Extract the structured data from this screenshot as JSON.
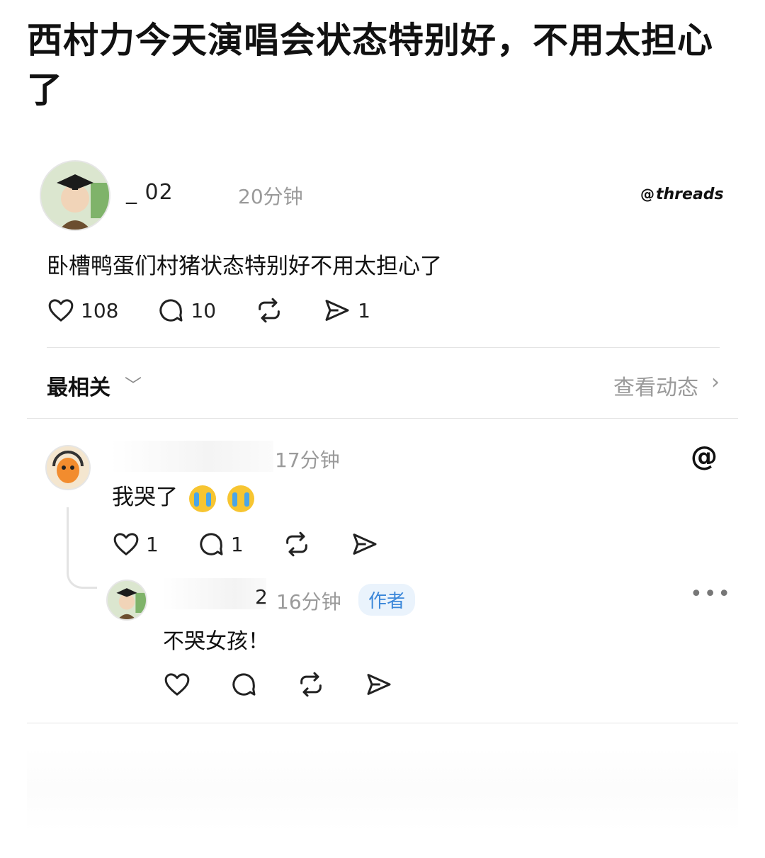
{
  "headline": "西村力今天演唱会状态特别好，不用太担心了",
  "post": {
    "username_visible": "_   02",
    "time": "20分钟",
    "brand": "threads",
    "text": "卧槽鸭蛋们村猪状态特别好不用太担心了",
    "likes": "108",
    "comments": "10",
    "shares": "1"
  },
  "sort": {
    "label": "最相关",
    "activity_link": "查看动态"
  },
  "comment": {
    "time": "17分钟",
    "text": "我哭了",
    "likes": "1",
    "comments": "1"
  },
  "reply": {
    "username_visible": "2",
    "time": "16分钟",
    "badge": "作者",
    "text": "不哭女孩！"
  },
  "icons": {
    "like": "heart-icon",
    "comment": "comment-bubble-icon",
    "repost": "repost-icon",
    "share": "send-icon",
    "brand": "threads-logo-icon",
    "more": "more-dots-icon"
  },
  "colors": {
    "badge_text": "#3b87d9",
    "badge_bg": "#eaf3fc",
    "muted": "#9a9a9a"
  }
}
